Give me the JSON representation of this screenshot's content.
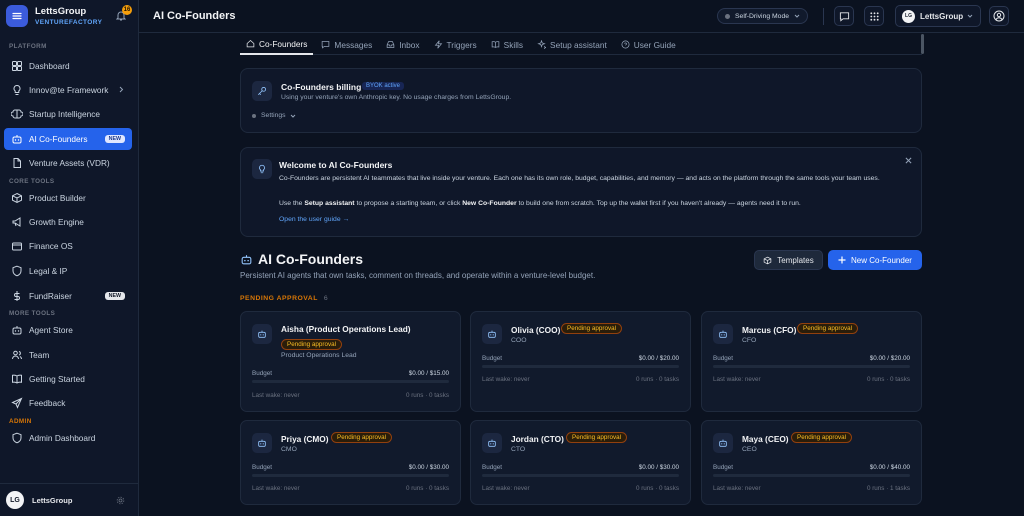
{
  "brand": {
    "name": "LettsGroup",
    "sub": "VENTUREFACTORY",
    "bell_count": "16"
  },
  "sidebar": {
    "sections": {
      "platform": "PLATFORM",
      "core_tools": "CORE TOOLS",
      "more_tools": "MORE TOOLS",
      "admin": "ADMIN"
    },
    "items": {
      "dashboard": "Dashboard",
      "innovate": "Innov@te Framework",
      "startup_intel": "Startup Intelligence",
      "ai_cofounders": "AI Co-Founders",
      "venture_assets": "Venture Assets (VDR)",
      "product_builder": "Product Builder",
      "growth_engine": "Growth Engine",
      "finance_os": "Finance OS",
      "legal_ip": "Legal & IP",
      "fundraiser": "FundRaiser",
      "agent_store": "Agent Store",
      "team": "Team",
      "getting_started": "Getting Started",
      "feedback": "Feedback",
      "admin_dashboard": "Admin Dashboard"
    },
    "new_badge": "NEW",
    "user": {
      "initials": "LG",
      "name": "LettsGroup"
    }
  },
  "header": {
    "title": "AI Co-Founders",
    "mode": "Self-Driving Mode",
    "workspace": "LettsGroup",
    "workspace_initials": "LG"
  },
  "tabs": [
    "Co-Founders",
    "Messages",
    "Inbox",
    "Triggers",
    "Skills",
    "Setup assistant",
    "User Guide"
  ],
  "billing": {
    "title": "Co-Founders billing",
    "badge": "BYOK active",
    "desc": "Using your venture's own Anthropic key. No usage charges from LettsGroup.",
    "settings": "Settings"
  },
  "welcome": {
    "title": "Welcome to AI Co-Founders",
    "p1": "Co-Founders are persistent AI teammates that live inside your venture. Each one has its own role, budget, capabilities, and memory — and acts on the platform through the same tools your team uses.",
    "p2_a": "Use the ",
    "p2_b": "Setup assistant",
    "p2_c": " to propose a starting team, or click ",
    "p2_d": "New Co-Founder",
    "p2_e": " to build one from scratch. Top up the wallet first if you haven't already — agents need it to run.",
    "link": "Open the user guide →"
  },
  "section": {
    "title": "AI Co-Founders",
    "subtitle": "Persistent AI agents that own tasks, comment on threads, and operate within a venture-level budget.",
    "templates": "Templates",
    "new_cofounder": "New Co-Founder",
    "pending_label": "PENDING APPROVAL",
    "pending_count": "6"
  },
  "agents": [
    {
      "name": "Aisha (Product Operations Lead)",
      "status": "Pending approval",
      "role": "Product Operations Lead",
      "budget_label": "Budget",
      "budget": "$0.00 / $15.00",
      "spent_fraction": 0,
      "wake": "Last wake: never",
      "runs": "0 runs · 0 tasks"
    },
    {
      "name": "Olivia (COO)",
      "status": "Pending approval",
      "role": "COO",
      "budget_label": "Budget",
      "budget": "$0.00 / $20.00",
      "spent_fraction": 0,
      "wake": "Last wake: never",
      "runs": "0 runs · 0 tasks"
    },
    {
      "name": "Marcus (CFO)",
      "status": "Pending approval",
      "role": "CFO",
      "budget_label": "Budget",
      "budget": "$0.00 / $20.00",
      "spent_fraction": 0,
      "wake": "Last wake: never",
      "runs": "0 runs · 0 tasks"
    },
    {
      "name": "Priya (CMO)",
      "status": "Pending approval",
      "role": "CMO",
      "budget_label": "Budget",
      "budget": "$0.00 / $30.00",
      "spent_fraction": 0,
      "wake": "Last wake: never",
      "runs": "0 runs · 0 tasks"
    },
    {
      "name": "Jordan (CTO)",
      "status": "Pending approval",
      "role": "CTO",
      "budget_label": "Budget",
      "budget": "$0.00 / $30.00",
      "spent_fraction": 0,
      "wake": "Last wake: never",
      "runs": "0 runs · 0 tasks"
    },
    {
      "name": "Maya (CEO)",
      "status": "Pending approval",
      "role": "CEO",
      "budget_label": "Budget",
      "budget": "$0.00 / $40.00",
      "spent_fraction": 0,
      "wake": "Last wake: never",
      "runs": "0 runs · 1 tasks"
    }
  ],
  "colors": {
    "accent": "#2563eb",
    "pending": "#d97706",
    "background": "#0b1220"
  }
}
